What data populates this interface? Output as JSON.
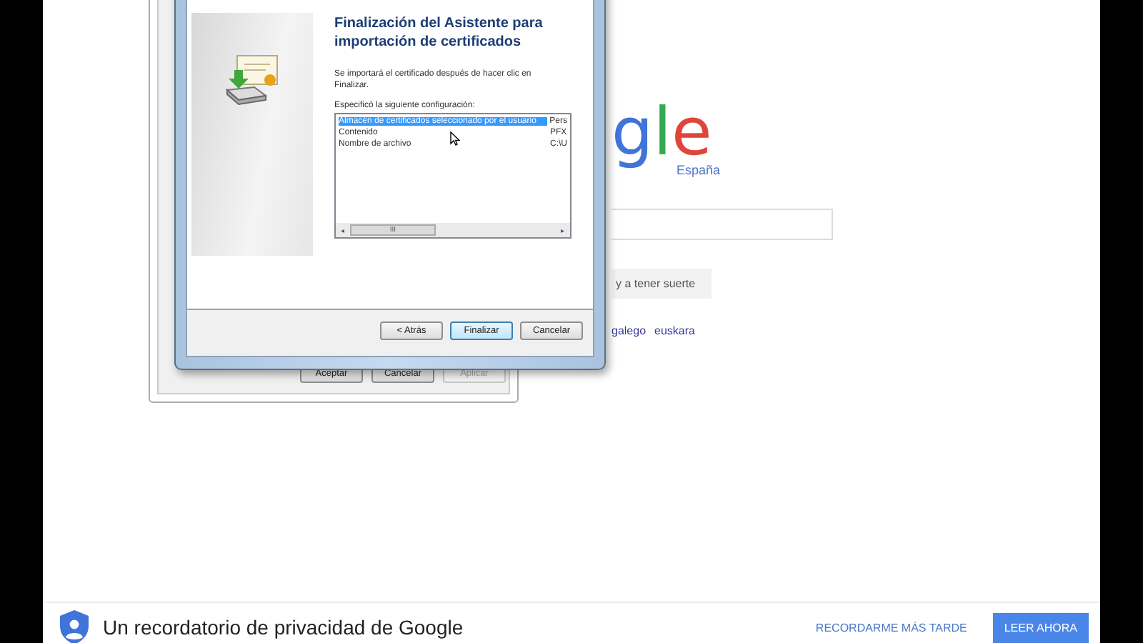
{
  "google": {
    "logo": [
      {
        "text": "g",
        "color": "#3f74d8"
      },
      {
        "text": "l",
        "color": "#34a853"
      },
      {
        "text": "e",
        "color": "#e0443a"
      }
    ],
    "region": "España",
    "lucky_button": "y a tener suerte",
    "languages": [
      "galego",
      "euskara"
    ]
  },
  "back_dialog": {
    "buttons": [
      {
        "label": "Aceptar",
        "disabled": false
      },
      {
        "label": "Cancelar",
        "disabled": false
      },
      {
        "label": "Aplicar",
        "disabled": true
      }
    ]
  },
  "wizard": {
    "heading": "Finalización del Asistente para importación de certificados",
    "intro": "Se importará el certificado después de hacer clic en Finalizar.",
    "list_label": "Especificó la siguiente configuración:",
    "settings": [
      {
        "name": "Almacén de certificados seleccionado por el usuario",
        "value": "Pers",
        "selected": true
      },
      {
        "name": "Contenido",
        "value": "PFX",
        "selected": false
      },
      {
        "name": "Nombre de archivo",
        "value": "C:\\U",
        "selected": false
      }
    ],
    "scroll_grip": "III",
    "scroll_left": "◂",
    "scroll_right": "▸",
    "buttons": [
      {
        "label": "< Atrás",
        "default": false
      },
      {
        "label": "Finalizar",
        "default": true
      },
      {
        "label": "Cancelar",
        "default": false
      }
    ]
  },
  "privacy_bar": {
    "message": "Un recordatorio de privacidad de Google",
    "later": "RECORDARME MÁS TARDE",
    "read": "LEER AHORA"
  }
}
